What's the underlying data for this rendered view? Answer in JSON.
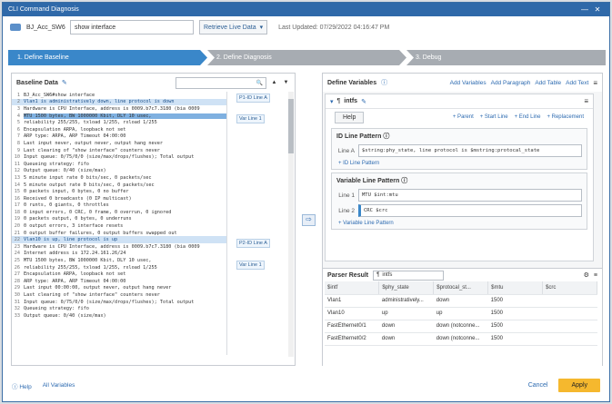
{
  "window": {
    "title": "CLI Command Diagnosis",
    "min": "—",
    "close": "✕"
  },
  "toolbar": {
    "device": "BJ_Acc_SW6",
    "command": "show interface",
    "retrieve_label": "Retrieve Live Data",
    "dropdown_glyph": "▾",
    "last_updated": "Last Updated: 07/29/2022 04:16:47 PM"
  },
  "steps": [
    "1. Define Baseline",
    "2. Define Diagnosis",
    "3. Debug"
  ],
  "baseline": {
    "title": "Baseline Data",
    "edit_icon": "✎",
    "search_icon": "🔍",
    "up": "▲",
    "down": "▼",
    "lines": [
      {
        "n": "1",
        "t": "BJ_Acc_SW6#show interface"
      },
      {
        "n": "2",
        "t": "Vlan1 is administratively down, line protocol is down"
      },
      {
        "n": "3",
        "t": "  Hardware is CPU Interface, address is 0009.b7c7.3180 (bia 0009"
      },
      {
        "n": "4",
        "t": "  MTU 1500 bytes, BW 1000000 Kbit, DLY 10 usec,"
      },
      {
        "n": "5",
        "t": "     reliability 255/255, txload 1/255, rxload 1/255"
      },
      {
        "n": "6",
        "t": "  Encapsulation ARPA, loopback not set"
      },
      {
        "n": "7",
        "t": "  ARP type: ARPA, ARP Timeout 04:00:00"
      },
      {
        "n": "8",
        "t": "  Last input never, output never, output hang never"
      },
      {
        "n": "9",
        "t": "  Last clearing of \"show interface\" counters never"
      },
      {
        "n": "10",
        "t": "  Input queue: 0/75/0/0 (size/max/drops/flushes); Total output"
      },
      {
        "n": "11",
        "t": "  Queueing strategy: fifo"
      },
      {
        "n": "12",
        "t": "  Output queue: 0/40 (size/max)"
      },
      {
        "n": "13",
        "t": "  5 minute input rate 0 bits/sec, 0 packets/sec"
      },
      {
        "n": "14",
        "t": "  5 minute output rate 0 bits/sec, 0 packets/sec"
      },
      {
        "n": "15",
        "t": "     0 packets input, 0 bytes, 0 no buffer"
      },
      {
        "n": "16",
        "t": "     Received 0 broadcasts (0 IP multicast)"
      },
      {
        "n": "17",
        "t": "     0 runts, 0 giants, 0 throttles"
      },
      {
        "n": "18",
        "t": "     0 input errors, 0 CRC, 0 frame, 0 overrun, 0 ignored"
      },
      {
        "n": "19",
        "t": "     0 packets output, 0 bytes, 0 underruns"
      },
      {
        "n": "20",
        "t": "     0 output errors, 3 interface resets"
      },
      {
        "n": "21",
        "t": "     0 output buffer failures, 0 output buffers swapped out"
      },
      {
        "n": "22",
        "t": "Vlan10 is up, line protocol is up"
      },
      {
        "n": "23",
        "t": "  Hardware is CPU Interface, address is 0009.b7c7.3180 (bia 0009"
      },
      {
        "n": "24",
        "t": "  Internet address is 172.24.161.26/24"
      },
      {
        "n": "25",
        "t": "  MTU 1500 bytes, BW 1000000 Kbit, DLY 10 usec,"
      },
      {
        "n": "26",
        "t": "     reliability 255/255, txload 1/255, rxload 1/255"
      },
      {
        "n": "27",
        "t": "  Encapsulation ARPA, loopback not set"
      },
      {
        "n": "28",
        "t": "  ARP type: ARPA, ARP Timeout 04:00:00"
      },
      {
        "n": "29",
        "t": "  Last input 00:00:00, output never, output hang never"
      },
      {
        "n": "30",
        "t": "  Last clearing of \"show interface\" counters never"
      },
      {
        "n": "31",
        "t": "  Input queue: 0/75/0/0 (size/max/drops/flushes); Total output"
      },
      {
        "n": "32",
        "t": "  Queueing strategy: fifo"
      },
      {
        "n": "33",
        "t": "  Output queue: 0/40 (size/max)"
      }
    ],
    "tags": [
      "P1-ID Line A",
      "Var Line 1",
      "P2-ID Line A",
      "Var Line 1"
    ]
  },
  "define": {
    "title": "Define Variables",
    "info_icon": "ⓘ",
    "add_variables": "Add Variables",
    "add_paragraph": "Add Paragraph",
    "add_table": "Add Table",
    "add_text": "Add Text",
    "menu_icon": "≡",
    "para_name": "intfs",
    "help": "Help",
    "links": [
      "+ Parent",
      "+ Start Line",
      "+ End Line",
      "+ Replacement"
    ],
    "id_pattern_title": "ID Line Pattern",
    "id_line_label": "Line A",
    "id_line_value": "$string:phy_state, line protocol is $mstring:protocal_state",
    "add_id_line": "+ ID Line Pattern",
    "var_pattern_title": "Variable Line Pattern",
    "var_lines": [
      {
        "label": "Line 1",
        "value": "MTU $int:mtu"
      },
      {
        "label": "Line 2",
        "value": "CRC $crc"
      }
    ],
    "add_var_line": "+ Variable Line Pattern"
  },
  "parser": {
    "title": "Parser Result",
    "selected": "intfs",
    "columns": [
      "$intf",
      "$phy_state",
      "$protocal_st...",
      "$mtu",
      "$crc"
    ],
    "rows": [
      [
        "Vlan1",
        "administratively...",
        "down",
        "1500",
        ""
      ],
      [
        "Vlan10",
        "up",
        "up",
        "1500",
        ""
      ],
      [
        "FastEthernet0/1",
        "down",
        "down (notconne...",
        "1500",
        ""
      ],
      [
        "FastEthernet0/2",
        "down",
        "down (notconne...",
        "1500",
        ""
      ]
    ]
  },
  "footer": {
    "help": "Help",
    "all_variables": "All Variables",
    "cancel": "Cancel",
    "apply": "Apply"
  }
}
